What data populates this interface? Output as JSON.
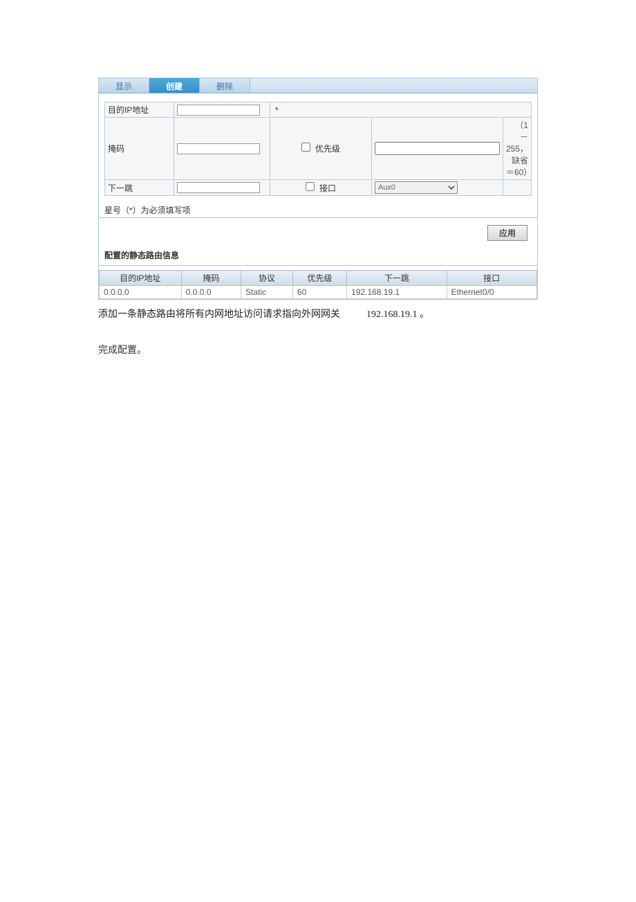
{
  "tabs": {
    "display": "显示",
    "create": "创建",
    "delete": "删除"
  },
  "form": {
    "dest_label": "目的IP地址",
    "mask_label": "掩码",
    "nexthop_label": "下一跳",
    "priority_chk": "优先级",
    "interface_chk": "接口",
    "priority_hint": "（1－255，缺省＝60）",
    "interface_value": "Aux0",
    "req_mark": "*",
    "required_note": "星号（*）为必须填写项",
    "apply_btn": "应用"
  },
  "section_title": "配置的静态路由信息",
  "table": {
    "headers": {
      "dest": "目的IP地址",
      "mask": "掩码",
      "proto": "协议",
      "pri": "优先级",
      "nh": "下一跳",
      "if": "接口"
    },
    "row": {
      "dest": "0.0.0.0",
      "mask": "0.0.0.0",
      "proto": "Static",
      "pri": "60",
      "nh": "192.168.19.1",
      "if": "Ethernet0/0"
    }
  },
  "desc": {
    "line1a": "添加一条静态路由将所有内网地址访问请求指向外网网关",
    "line1b": "192.168.19.1  。",
    "line2": "完成配置。"
  }
}
